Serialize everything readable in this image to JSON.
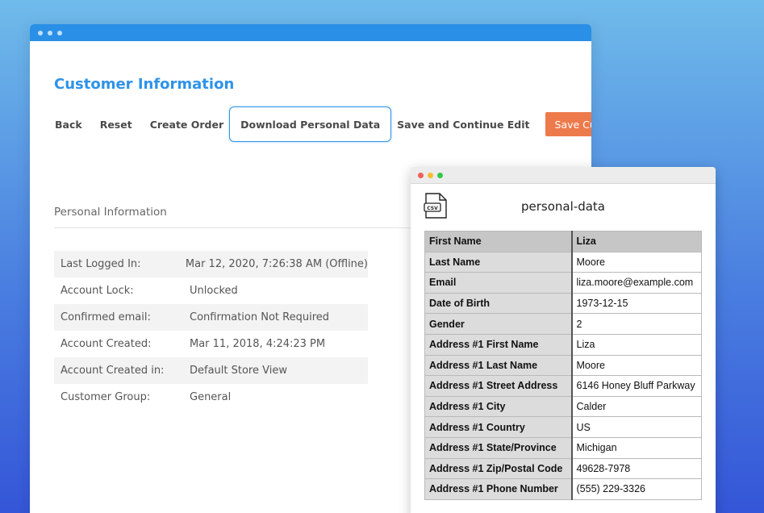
{
  "customer_page": {
    "title": "Customer Information",
    "toolbar": {
      "back": "Back",
      "reset": "Reset",
      "create_order": "Create Order",
      "download": "Download Personal Data",
      "save_continue": "Save and Continue Edit",
      "save": "Save Customer"
    },
    "section_title": "Personal Information",
    "info_rows": [
      {
        "label": "Last Logged In:",
        "value": "Mar 12, 2020, 7:26:38 AM (Offline)"
      },
      {
        "label": "Account Lock:",
        "value": "Unlocked"
      },
      {
        "label": "Confirmed email:",
        "value": "Confirmation Not Required"
      },
      {
        "label": "Account Created:",
        "value": "Mar 11, 2018, 4:24:23 PM"
      },
      {
        "label": "Account Created in:",
        "value": "Default Store View"
      },
      {
        "label": "Customer Group:",
        "value": "General"
      }
    ]
  },
  "csv_window": {
    "file_name": "personal-data",
    "icon_text": "CSV",
    "rows": [
      {
        "key": "First Name",
        "value": "Liza"
      },
      {
        "key": "Last Name",
        "value": "Moore"
      },
      {
        "key": "Email",
        "value": "liza.moore@example.com"
      },
      {
        "key": "Date of Birth",
        "value": "1973-12-15"
      },
      {
        "key": "Gender",
        "value": "2"
      },
      {
        "key": "Address #1 First Name",
        "value": "Liza"
      },
      {
        "key": "Address #1 Last Name",
        "value": "Moore"
      },
      {
        "key": "Address #1 Street Address",
        "value": "6146 Honey Bluff Parkway"
      },
      {
        "key": "Address #1 City",
        "value": "Calder"
      },
      {
        "key": "Address #1 Country",
        "value": "US"
      },
      {
        "key": "Address #1 State/Province",
        "value": "Michigan"
      },
      {
        "key": "Address #1 Zip/Postal Code",
        "value": "49628-7978"
      },
      {
        "key": "Address #1 Phone Number",
        "value": "(555) 229-3326"
      }
    ]
  },
  "colors": {
    "accent_blue": "#2e93e8",
    "save_orange": "#ed7a4b",
    "titlebar_blue": "#2a8fe6"
  }
}
